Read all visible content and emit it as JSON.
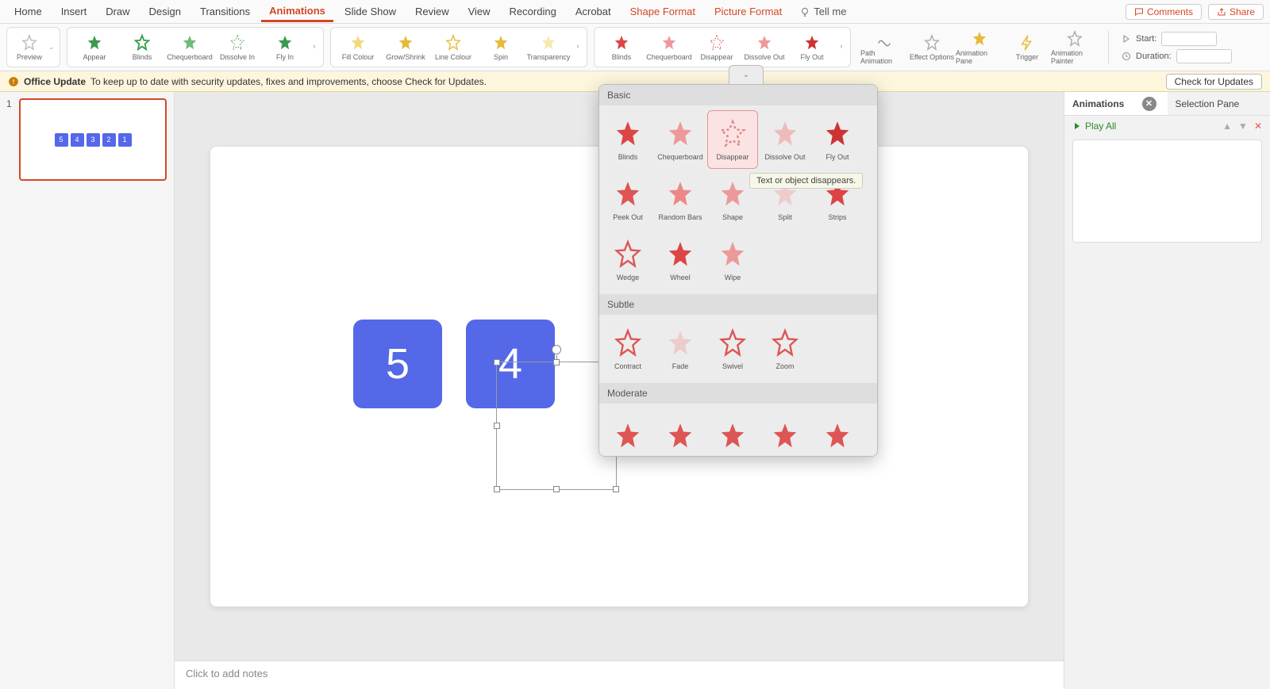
{
  "tabs": [
    "Home",
    "Insert",
    "Draw",
    "Design",
    "Transitions",
    "Animations",
    "Slide Show",
    "Review",
    "View",
    "Recording",
    "Acrobat",
    "Shape Format",
    "Picture Format"
  ],
  "active_tab": "Animations",
  "tell_me": "Tell me",
  "btn_comments": "Comments",
  "btn_share": "Share",
  "ribbon": {
    "preview": "Preview",
    "entrance": [
      "Appear",
      "Blinds",
      "Chequerboard",
      "Dissolve In",
      "Fly In"
    ],
    "emphasis": [
      "Fill Colour",
      "Grow/Shrink",
      "Line Colour",
      "Spin",
      "Transparency"
    ],
    "exit": [
      "Blinds",
      "Chequerboard",
      "Disappear",
      "Dissolve Out",
      "Fly Out"
    ],
    "extra": [
      "Path Animation",
      "Effect Options",
      "Animation Pane",
      "Trigger",
      "Animation Painter"
    ],
    "start": "Start:",
    "duration": "Duration:"
  },
  "banner": {
    "title": "Office Update",
    "msg": "To keep up to date with security updates, fixes and improvements, choose Check for Updates.",
    "btn": "Check for Updates"
  },
  "thumb_boxes": [
    "5",
    "4",
    "3",
    "2",
    "1"
  ],
  "slide_shapes": [
    "5",
    "4"
  ],
  "notes_placeholder": "Click to add notes",
  "rpane": {
    "tab1": "Animations",
    "tab2": "Selection Pane",
    "play": "Play All"
  },
  "dd": {
    "basic": "Basic",
    "basic_items": [
      "Blinds",
      "Chequerboard",
      "Disappear",
      "Dissolve Out",
      "Fly Out",
      "Peek Out",
      "Random Bars",
      "Shape",
      "Split",
      "Strips",
      "Wedge",
      "Wheel",
      "Wipe"
    ],
    "subtle": "Subtle",
    "subtle_items": [
      "Contract",
      "Fade",
      "Swivel",
      "Zoom"
    ],
    "moderate": "Moderate",
    "moderate_items": [
      "",
      "",
      "",
      "",
      ""
    ],
    "tooltip": "Text or object disappears."
  }
}
